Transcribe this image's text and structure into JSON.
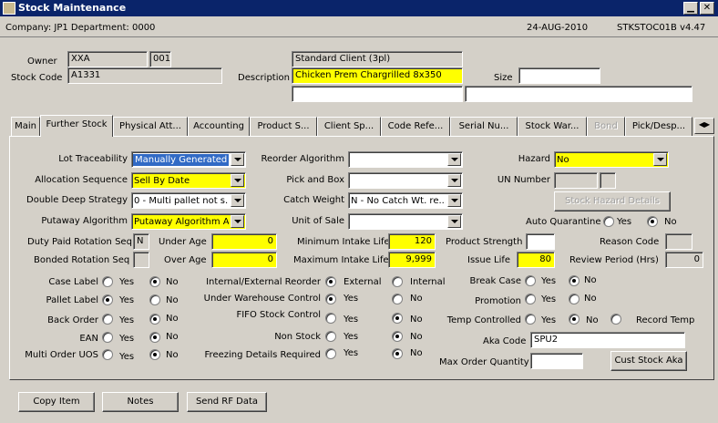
{
  "window": {
    "title": "Stock Maintenance",
    "minimize_glyph": "▁",
    "close_glyph": "✕",
    "icon": "app-icon"
  },
  "info": {
    "company": "Company:  JP1    Department:  0000",
    "date": "24-AUG-2010",
    "program": "STKSTOC01B  v4.47"
  },
  "header": {
    "owner_label": "Owner",
    "owner_value": "XXA",
    "owner_code": "001",
    "stock_code_label": "Stock Code",
    "stock_code_value": "A1331",
    "client_name": "Standard Client (3pl)",
    "description_label": "Description",
    "description_value": "Chicken Prem Chargrilled 8x350",
    "size_label": "Size",
    "size_value": ""
  },
  "tabs": [
    "Main",
    "Further Stock",
    "Physical Att...",
    "Accounting",
    "Product S...",
    "Client Sp...",
    "Code Refe...",
    "Serial Nu...",
    "Stock War...",
    "Bond",
    "Pick/Desp..."
  ],
  "tab_scroll_glyph": "◀▶",
  "form": {
    "lot_traceability": {
      "label": "Lot Traceability",
      "value": "Manually Generated"
    },
    "allocation_sequence": {
      "label": "Allocation Sequence",
      "value": "Sell By Date"
    },
    "double_deep_strategy": {
      "label": "Double Deep Strategy",
      "value": "0 - Multi pallet not s..."
    },
    "putaway_algorithm": {
      "label": "Putaway Algorithm",
      "value": "Putaway Algorithm A"
    },
    "reorder_algorithm": {
      "label": "Reorder Algorithm",
      "value": ""
    },
    "pick_and_box": {
      "label": "Pick and  Box",
      "value": ""
    },
    "catch_weight": {
      "label": "Catch Weight",
      "value": "N - No Catch Wt. re..."
    },
    "unit_of_sale": {
      "label": "Unit of Sale",
      "value": ""
    },
    "hazard": {
      "label": "Hazard",
      "value": "No"
    },
    "un_number": {
      "label": "UN Number",
      "value": ""
    },
    "stock_hazard_details": "Stock Hazard Details",
    "auto_quarantine": {
      "label": "Auto Quarantine",
      "yes": "Yes",
      "no": "No"
    },
    "duty_paid_rotation_seq": {
      "label": "Duty Paid Rotation Seq",
      "value": "N"
    },
    "bonded_rotation_seq": {
      "label": "Bonded Rotation Seq",
      "value": ""
    },
    "under_age": {
      "label": "Under Age",
      "value": "0"
    },
    "over_age": {
      "label": "Over Age",
      "value": "0"
    },
    "min_intake_life": {
      "label": "Minimum Intake Life",
      "value": "120"
    },
    "max_intake_life": {
      "label": "Maximum Intake Life",
      "value": "9,999"
    },
    "product_strength": {
      "label": "Product Strength",
      "value": ""
    },
    "issue_life": {
      "label": "Issue Life",
      "value": "80"
    },
    "reason_code": {
      "label": "Reason Code",
      "value": ""
    },
    "review_period": {
      "label": "Review Period (Hrs)",
      "value": "0"
    },
    "case_label": {
      "label": "Case Label",
      "yes": "Yes",
      "no": "No"
    },
    "pallet_label": {
      "label": "Pallet Label",
      "yes": "Yes",
      "no": "No"
    },
    "back_order": {
      "label": "Back Order",
      "yes": "Yes",
      "no": "No"
    },
    "ean": {
      "label": "EAN",
      "yes": "Yes",
      "no": "No"
    },
    "multi_order_uos": {
      "label": "Multi Order UOS",
      "yes": "Yes",
      "no": "No"
    },
    "int_ext_reorder": {
      "label": "Internal/External Reorder",
      "external": "External",
      "internal": "Internal"
    },
    "under_wh_control": {
      "label": "Under Warehouse Control",
      "yes": "Yes",
      "no": "No"
    },
    "fifo_stock_control": {
      "label": "FIFO Stock Control",
      "yes": "Yes",
      "no": "No"
    },
    "non_stock": {
      "label": "Non Stock",
      "yes": "Yes",
      "no": "No"
    },
    "freezing_details": {
      "label": "Freezing Details Required",
      "yes": "Yes",
      "no": "No"
    },
    "break_case": {
      "label": "Break Case",
      "yes": "Yes",
      "no": "No"
    },
    "promotion": {
      "label": "Promotion",
      "yes": "Yes",
      "no": "No"
    },
    "temp_controlled": {
      "label": "Temp Controlled",
      "yes": "Yes",
      "no": "No",
      "record": "Record Temp"
    },
    "aka_code": {
      "label": "Aka Code",
      "value": "SPU2"
    },
    "max_order_qty": {
      "label": "Max Order Quantity",
      "value": ""
    },
    "cust_stock_aka": "Cust Stock Aka"
  },
  "footer": {
    "copy_item": "Copy Item",
    "notes": "Notes",
    "send_rf": "Send RF Data"
  }
}
